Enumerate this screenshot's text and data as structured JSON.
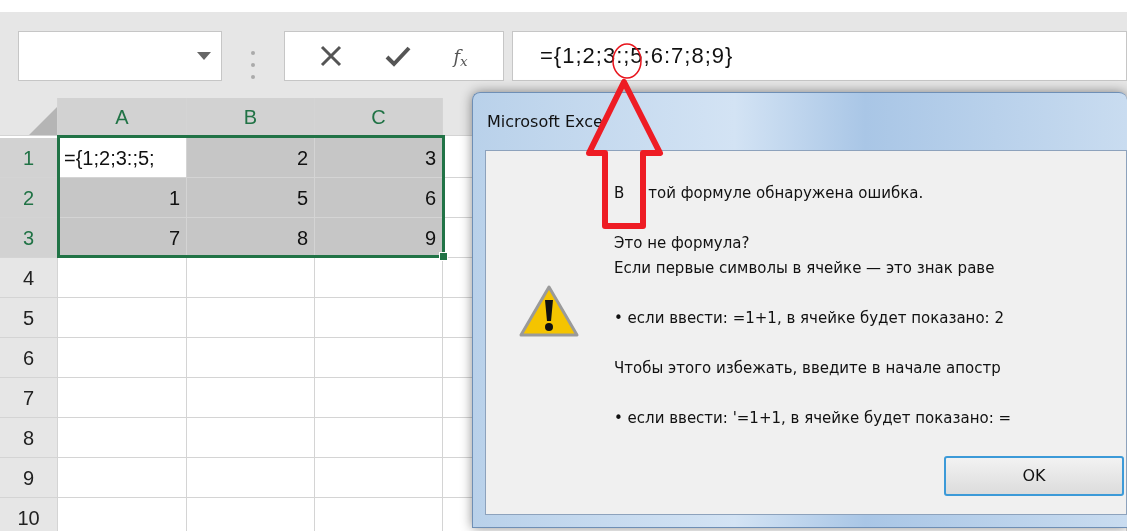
{
  "formula_bar": {
    "function_label": "f$_{x}$",
    "formula": "={1;2;3:;5;6:7;8;9}"
  },
  "sheet": {
    "columns": [
      {
        "label": "A",
        "selected": true
      },
      {
        "label": "B",
        "selected": true
      },
      {
        "label": "C",
        "selected": true
      }
    ],
    "rows": [
      {
        "label": "1",
        "selected": true,
        "cells": [
          {
            "text": "={1;2;3:;5;",
            "kind": "text",
            "selected": true,
            "active": true
          },
          {
            "text": "2",
            "kind": "number",
            "selected": true,
            "active": false
          },
          {
            "text": "3",
            "kind": "number",
            "selected": true,
            "active": false
          }
        ]
      },
      {
        "label": "2",
        "selected": true,
        "cells": [
          {
            "text": "1",
            "kind": "number",
            "selected": true,
            "active": false
          },
          {
            "text": "5",
            "kind": "number",
            "selected": true,
            "active": false
          },
          {
            "text": "6",
            "kind": "number",
            "selected": true,
            "active": false
          }
        ]
      },
      {
        "label": "3",
        "selected": true,
        "cells": [
          {
            "text": "7",
            "kind": "number",
            "selected": true,
            "active": false
          },
          {
            "text": "8",
            "kind": "number",
            "selected": true,
            "active": false
          },
          {
            "text": "9",
            "kind": "number",
            "selected": true,
            "active": false
          }
        ]
      },
      {
        "label": "4",
        "selected": false
      },
      {
        "label": "5",
        "selected": false
      },
      {
        "label": "6",
        "selected": false
      },
      {
        "label": "7",
        "selected": false
      },
      {
        "label": "8",
        "selected": false
      },
      {
        "label": "9",
        "selected": false
      },
      {
        "label": "10",
        "selected": false
      }
    ]
  },
  "dialog": {
    "title": "Microsoft Exce",
    "paragraphs": [
      {
        "lines": [
          [
            "В",
            "той формуле обнаружена ошибка."
          ]
        ]
      },
      {
        "lines": [
          "Это не формула?",
          "Если первые символы в ячейке — это знак раве"
        ]
      },
      {
        "lines": [
          "• если ввести: =1+1, в ячейке будет показано: 2"
        ]
      },
      {
        "lines": [
          "Чтобы этого избежать, введите в начале апостр"
        ]
      },
      {
        "lines": [
          "• если ввести: '=1+1, в ячейке будет показано: ="
        ]
      }
    ],
    "buttons": [
      {
        "label": "OK"
      }
    ]
  },
  "annotation": {
    "arrow": true,
    "circle": true
  }
}
